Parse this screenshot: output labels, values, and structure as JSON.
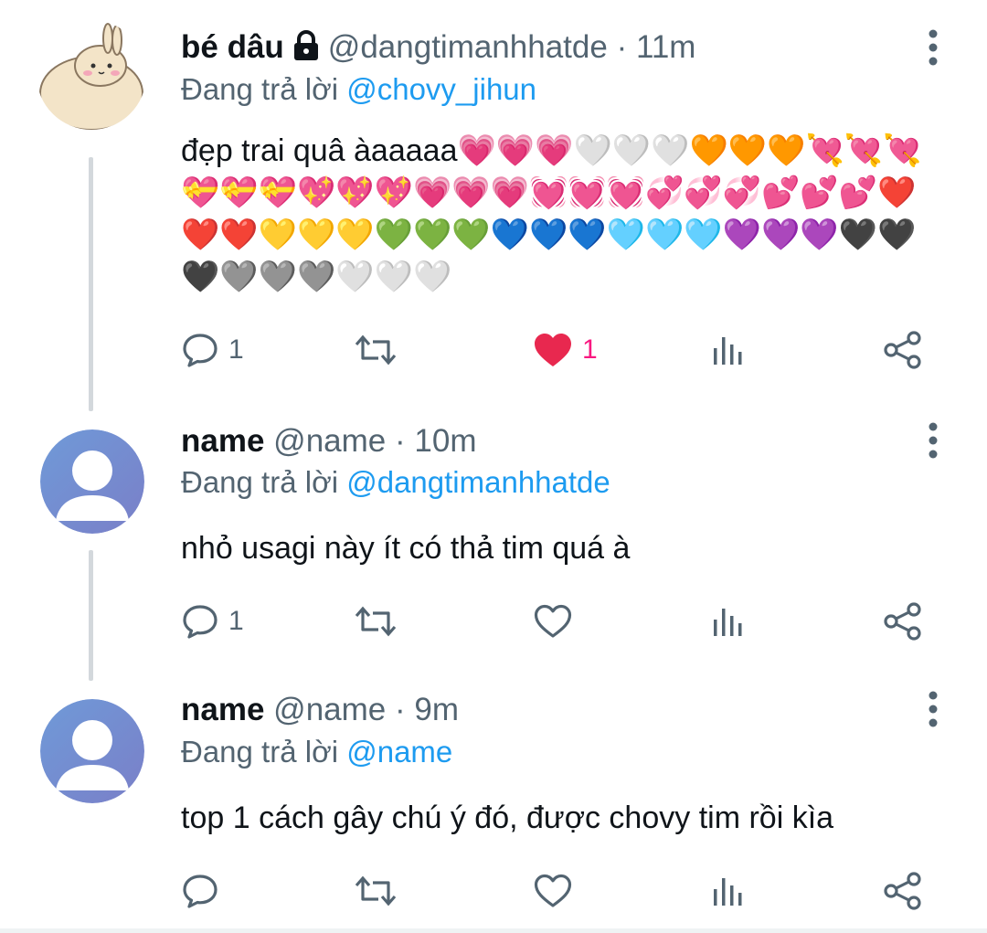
{
  "colors": {
    "accent": "#1d9bf0",
    "secondary_text": "#536471",
    "like_active": "#f91880",
    "thread_line": "#d3d8dc"
  },
  "tweets": [
    {
      "display_name": "bé dâu",
      "protected_icon": "lock-icon",
      "handle": "@dangtimanhhatde",
      "separator": "·",
      "time": "11m",
      "replying_prefix": "Đang trả lời",
      "replying_to": "@chovy_jihun",
      "text": "đẹp trai quâ àaaaaa💗💗💗🤍🤍🤍🧡🧡🧡💘💘💘💝💝💝💖💖💖💗💗💗💓💓💓💞💞💞💕💕💕❤️❤️❤️💛💛💛💚💚💚💙💙💙🩵🩵🩵💜💜💜🖤🖤🖤🩶🩶🩶🤍🤍🤍",
      "avatar_icon": "rabbit-avatar",
      "actions": {
        "reply_count": "1",
        "retweet_count": "",
        "like_count": "1",
        "liked": true
      }
    },
    {
      "display_name": "name",
      "handle": "@name",
      "separator": "·",
      "time": "10m",
      "replying_prefix": "Đang trả lời",
      "replying_to": "@dangtimanhhatde",
      "text": "nhỏ usagi này ít có thả tim quá à",
      "avatar_icon": "default-user-avatar",
      "actions": {
        "reply_count": "1",
        "retweet_count": "",
        "like_count": "",
        "liked": false
      }
    },
    {
      "display_name": "name",
      "handle": "@name",
      "separator": "·",
      "time": "9m",
      "replying_prefix": "Đang trả lời",
      "replying_to": "@name",
      "text": "top 1 cách gây chú ý đó, được chovy tim rồi kìa",
      "avatar_icon": "default-user-avatar",
      "actions": {
        "reply_count": "",
        "retweet_count": "",
        "like_count": "",
        "liked": false
      }
    }
  ]
}
